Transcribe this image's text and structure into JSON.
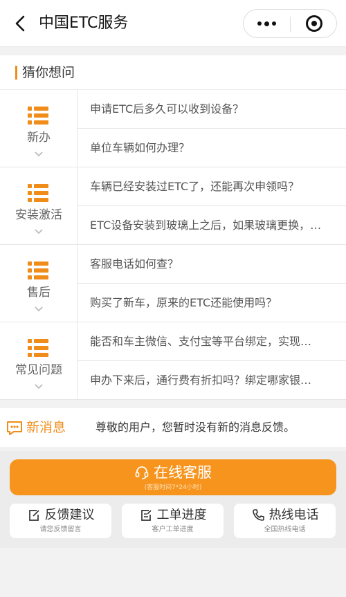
{
  "nav": {
    "title": "中国ETC服务"
  },
  "guess": {
    "title": "猜你想问",
    "categories": [
      {
        "name": "新办",
        "questions": [
          "申请ETC后多久可以收到设备？",
          "单位车辆如何办理？"
        ]
      },
      {
        "name": "安装激活",
        "questions": [
          "车辆已经安装过ETC了，还能再次申领吗？",
          "ETC设备安装到玻璃上之后，如果玻璃更换，…"
        ]
      },
      {
        "name": "售后",
        "questions": [
          "客服电话如何查？",
          "购买了新车，原来的ETC还能使用吗？"
        ]
      },
      {
        "name": "常见问题",
        "questions": [
          "能否和车主微信、支付宝等平台绑定，实现…",
          "申办下来后，通行费有折扣吗？绑定哪家银…"
        ]
      }
    ]
  },
  "news": {
    "label": "新消息",
    "text": "尊敬的用户，您暂时没有新的消息反馈。"
  },
  "online_service": {
    "label": "在线客服",
    "hours": "(客服时间7*24小时)"
  },
  "actions": [
    {
      "label": "反馈建议",
      "sub": "请您反馈留言"
    },
    {
      "label": "工单进度",
      "sub": "客户工单进度"
    },
    {
      "label": "热线电话",
      "sub": "全国热线电话"
    }
  ],
  "colors": {
    "accent": "#f08c1a",
    "button": "#f7941d"
  }
}
